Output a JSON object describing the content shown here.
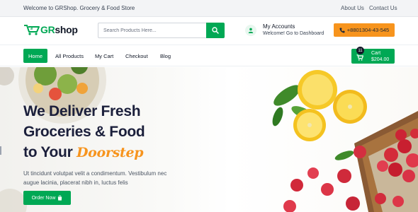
{
  "topbar": {
    "welcome": "Welcome to GRShop. Grocery & Food Store",
    "links": [
      "About Us",
      "Contact Us"
    ]
  },
  "header": {
    "logo_gr": "GR",
    "logo_shop": "shop",
    "search_placeholder": "Search Products Here...",
    "account_title": "My Accounts",
    "account_sub": "Welcome! Go to Dashboard",
    "phone": "+8801304-43-545"
  },
  "nav": {
    "items": [
      "Home",
      "All Products",
      "My Cart",
      "Checkout",
      "Blog"
    ],
    "active": "Home"
  },
  "cart": {
    "count": "11",
    "label": "Cart",
    "total": "$204.00"
  },
  "hero": {
    "line1": "We Deliver Fresh",
    "line2": "Groceries & Food",
    "line3": "to Your",
    "line3_accent": "Doorstep",
    "desc1": "Ut tincidunt volutpat velit a condimentum. Vestibulum nec",
    "desc2": "augue lacinia, placerat nibh in, luctus felis",
    "button": "Order Now"
  },
  "colors": {
    "brand_green": "#00a854",
    "accent_orange": "#f7941d",
    "heading_navy": "#1b1f3b"
  },
  "icons": [
    "cart-logo-icon",
    "search-icon",
    "user-icon",
    "phone-icon",
    "shopping-cart-icon",
    "bag-icon"
  ]
}
